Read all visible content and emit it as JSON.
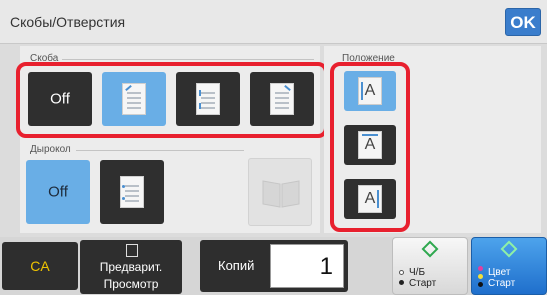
{
  "header": {
    "title": "Скобы/Отверстия",
    "ok_label": "OK"
  },
  "staple": {
    "label": "Скоба",
    "options": [
      {
        "label": "Off",
        "selected": false
      },
      {
        "label": "",
        "selected": true,
        "icon": "staple-corner-icon"
      },
      {
        "label": "",
        "selected": false,
        "icon": "staple-two-left-icon"
      },
      {
        "label": "",
        "selected": false,
        "icon": "staple-right-corner-icon"
      }
    ]
  },
  "punch": {
    "label": "Дырокол",
    "options": [
      {
        "label": "Off",
        "selected": true
      },
      {
        "label": "",
        "selected": false,
        "icon": "punch-left-icon"
      }
    ]
  },
  "position": {
    "label": "Положение",
    "options": [
      {
        "glyph": "A",
        "selected": true,
        "icon": "position-left-icon"
      },
      {
        "glyph": "A",
        "selected": false,
        "icon": "position-top-icon"
      },
      {
        "glyph": "A",
        "selected": false,
        "icon": "position-right-icon"
      }
    ]
  },
  "bottom": {
    "ca_label": "CA",
    "preview_line1": "Предварит.",
    "preview_line2": "Просмотр",
    "copies_label": "Копий",
    "copies_value": "1",
    "bw_start_line1": "Ч/Б",
    "bw_start_line2": "Старт",
    "color_start_line1": "Цвет",
    "color_start_line2": "Старт"
  },
  "colors": {
    "accent": "#3a7dcc",
    "selected_tile": "#69aee6",
    "highlight": "#e8202e",
    "ca_text": "#f0c400"
  }
}
